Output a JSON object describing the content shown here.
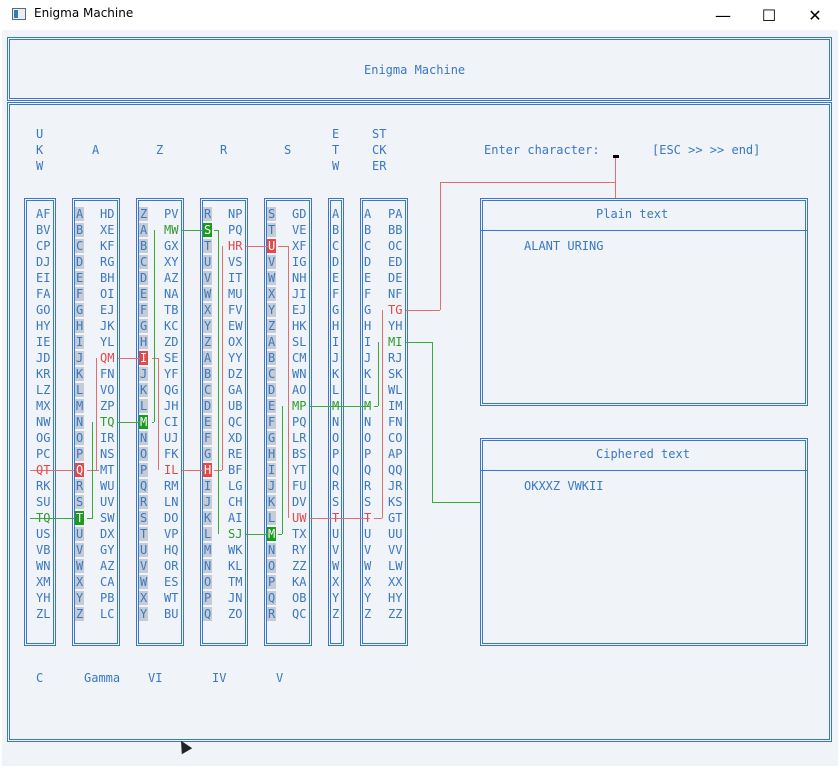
{
  "window": {
    "title": "Enigma Machine",
    "min_icon": "minimize-icon",
    "max_icon": "maximize-icon",
    "close_icon": "close-icon"
  },
  "header": {
    "title": "Enigma Machine"
  },
  "labels": {
    "ukw": [
      "U",
      "K",
      "W"
    ],
    "a": "A",
    "z": "Z",
    "r": "R",
    "s": "S",
    "etw": [
      "E",
      "T",
      "W"
    ],
    "stecker": [
      "ST",
      "CK",
      "ER"
    ]
  },
  "prompt": {
    "label": "Enter character:",
    "hint": "[ESC >> >> end]"
  },
  "plain_text": {
    "title": "Plain text",
    "value": "ALANT URING"
  },
  "ciphered_text": {
    "title": "Ciphered text",
    "value": "OKXXZ VWKII"
  },
  "columns": {
    "ukw": [
      "AF",
      "BV",
      "CP",
      "DJ",
      "EI",
      "FA",
      "GO",
      "HY",
      "IE",
      "JD",
      "KR",
      "LZ",
      "MX",
      "NW",
      "OG",
      "PC",
      "QT",
      "RK",
      "SU",
      "TQ",
      "US",
      "VB",
      "WN",
      "XM",
      "YH",
      "ZL"
    ],
    "rotor_gamma_letters": [
      "A",
      "B",
      "C",
      "D",
      "E",
      "F",
      "G",
      "H",
      "I",
      "J",
      "K",
      "L",
      "M",
      "N",
      "O",
      "P",
      "Q",
      "R",
      "S",
      "T",
      "U",
      "V",
      "W",
      "X",
      "Y",
      "Z"
    ],
    "rotor_gamma_pairs": [
      "HD",
      "XE",
      "KF",
      "RG",
      "BH",
      "OI",
      "EJ",
      "JK",
      "YL",
      "QM",
      "FN",
      "VO",
      "ZP",
      "TQ",
      "IR",
      "NS",
      "MT",
      "WU",
      "UV",
      "SW",
      "DX",
      "GY",
      "AZ",
      "CA",
      "PB",
      "LC"
    ],
    "rotor_vi_letters": [
      "Z",
      "A",
      "B",
      "C",
      "D",
      "E",
      "F",
      "G",
      "H",
      "I",
      "J",
      "K",
      "L",
      "M",
      "N",
      "O",
      "P",
      "Q",
      "R",
      "S",
      "T",
      "U",
      "V",
      "W",
      "X",
      "Y"
    ],
    "rotor_vi_pairs": [
      "PV",
      "MW",
      "GX",
      "XY",
      "AZ",
      "NA",
      "TB",
      "KC",
      "ZD",
      "SE",
      "YF",
      "QG",
      "JH",
      "CI",
      "UJ",
      "FK",
      "IL",
      "RM",
      "LN",
      "DO",
      "VP",
      "HQ",
      "OR",
      "ES",
      "WT",
      "BU"
    ],
    "rotor_iv_letters": [
      "R",
      "S",
      "T",
      "U",
      "V",
      "W",
      "X",
      "Y",
      "Z",
      "A",
      "B",
      "C",
      "D",
      "E",
      "F",
      "G",
      "H",
      "I",
      "J",
      "K",
      "L",
      "M",
      "N",
      "O",
      "P",
      "Q"
    ],
    "rotor_iv_pairs": [
      "NP",
      "PQ",
      "HR",
      "VS",
      "IT",
      "MU",
      "FV",
      "EW",
      "OX",
      "YY",
      "DZ",
      "GA",
      "UB",
      "QC",
      "XD",
      "RE",
      "BF",
      "LG",
      "CH",
      "AI",
      "SJ",
      "WK",
      "KL",
      "TM",
      "JN",
      "ZO"
    ],
    "rotor_v_letters": [
      "S",
      "T",
      "U",
      "V",
      "W",
      "X",
      "Y",
      "Z",
      "A",
      "B",
      "C",
      "D",
      "E",
      "F",
      "G",
      "H",
      "I",
      "J",
      "K",
      "L",
      "M",
      "N",
      "O",
      "P",
      "Q",
      "R"
    ],
    "rotor_v_pairs": [
      "GD",
      "VE",
      "XF",
      "IG",
      "NH",
      "JI",
      "EJ",
      "HK",
      "SL",
      "CM",
      "WN",
      "AO",
      "MP",
      "PQ",
      "LR",
      "BS",
      "YT",
      "FU",
      "DV",
      "UW",
      "TX",
      "RY",
      "ZZ",
      "KA",
      "OB",
      "QC"
    ],
    "etw": [
      "A",
      "B",
      "C",
      "D",
      "E",
      "F",
      "G",
      "H",
      "I",
      "J",
      "K",
      "L",
      "M",
      "N",
      "O",
      "P",
      "Q",
      "R",
      "S",
      "T",
      "U",
      "V",
      "W",
      "X",
      "Y",
      "Z"
    ],
    "stecker_letters": [
      "A",
      "B",
      "C",
      "D",
      "E",
      "F",
      "G",
      "H",
      "I",
      "J",
      "K",
      "L",
      "M",
      "N",
      "O",
      "P",
      "Q",
      "R",
      "S",
      "T",
      "U",
      "V",
      "W",
      "X",
      "Y",
      "Z"
    ],
    "stecker_pairs": [
      "PA",
      "BB",
      "OC",
      "ED",
      "DE",
      "NF",
      "TG",
      "YH",
      "MI",
      "RJ",
      "SK",
      "WL",
      "IM",
      "FN",
      "CO",
      "AP",
      "QQ",
      "JR",
      "KS",
      "GT",
      "UU",
      "VV",
      "LW",
      "XX",
      "HY",
      "ZZ"
    ]
  },
  "bottom_labels": [
    "C",
    "Gamma",
    "VI",
    "IV",
    "V"
  ],
  "colors": {
    "text": "#3a78c4",
    "forward_wire": "#e07070",
    "return_wire": "#3aaa3a",
    "background": "#f0f3f7"
  }
}
